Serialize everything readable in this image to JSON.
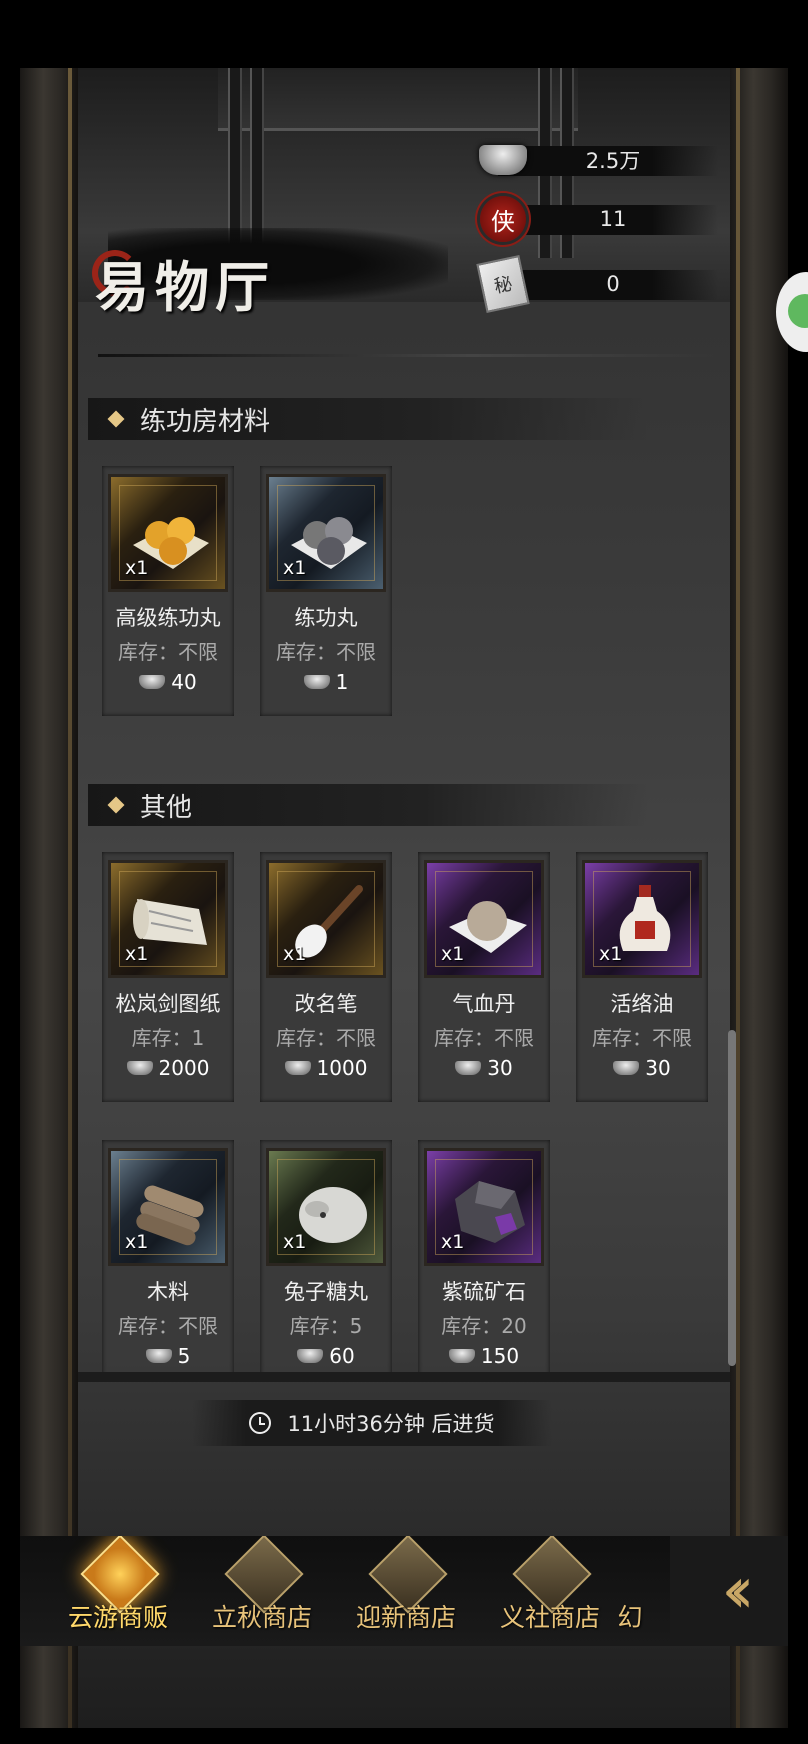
{
  "header": {
    "title": "易物厅",
    "currencies": [
      {
        "icon": "silver-ingot-icon",
        "value": "2.5万"
      },
      {
        "icon": "chivalry-seal-icon",
        "value": "11",
        "glyph": "侠"
      },
      {
        "icon": "secret-book-icon",
        "value": "0",
        "glyph": "秘"
      }
    ]
  },
  "sections": [
    {
      "label": "练功房材料",
      "items": [
        {
          "name": "高级练功丸",
          "qty": "x1",
          "stock": "库存：不限",
          "price": "40",
          "rarity": "gold",
          "icon": "golden-pills-icon"
        },
        {
          "name": "练功丸",
          "qty": "x1",
          "stock": "库存：不限",
          "price": "1",
          "rarity": "blue",
          "icon": "gray-pills-icon"
        }
      ]
    },
    {
      "label": "其他",
      "items": [
        {
          "name": "松岚剑图纸",
          "qty": "x1",
          "stock": "库存：1",
          "price": "2000",
          "rarity": "gold",
          "icon": "blueprint-scroll-icon"
        },
        {
          "name": "改名笔",
          "qty": "x1",
          "stock": "库存：不限",
          "price": "1000",
          "rarity": "gold",
          "icon": "brush-pen-icon"
        },
        {
          "name": "气血丹",
          "qty": "x1",
          "stock": "库存：不限",
          "price": "30",
          "rarity": "purple",
          "icon": "blood-pill-icon"
        },
        {
          "name": "活络油",
          "qty": "x1",
          "stock": "库存：不限",
          "price": "30",
          "rarity": "purple",
          "icon": "oil-bottle-icon"
        },
        {
          "name": "木料",
          "qty": "x1",
          "stock": "库存：不限",
          "price": "5",
          "rarity": "blue",
          "icon": "wood-logs-icon"
        },
        {
          "name": "兔子糖丸",
          "qty": "x1",
          "stock": "库存：5",
          "price": "60",
          "rarity": "green",
          "icon": "rabbit-candy-icon"
        },
        {
          "name": "紫硫矿石",
          "qty": "x1",
          "stock": "库存：20",
          "price": "150",
          "rarity": "purple",
          "icon": "purple-ore-icon"
        }
      ]
    }
  ],
  "restock": {
    "text": "11小时36分钟 后进货",
    "icon": "clock-icon"
  },
  "tabs": [
    {
      "label": "云游商贩",
      "active": true
    },
    {
      "label": "立秋商店",
      "active": false
    },
    {
      "label": "迎新商店",
      "active": false
    },
    {
      "label": "义社商店",
      "active": false,
      "glyph": "義"
    },
    {
      "label": "幻",
      "active": false
    }
  ],
  "colors": {
    "accent_gold": "#e5c787",
    "seal_red": "#b3231b",
    "rarity_gold": "#8c6d2c",
    "rarity_blue": "#6b7f8f",
    "rarity_purple": "#7b3fa8",
    "rarity_green": "#6a7a50"
  }
}
